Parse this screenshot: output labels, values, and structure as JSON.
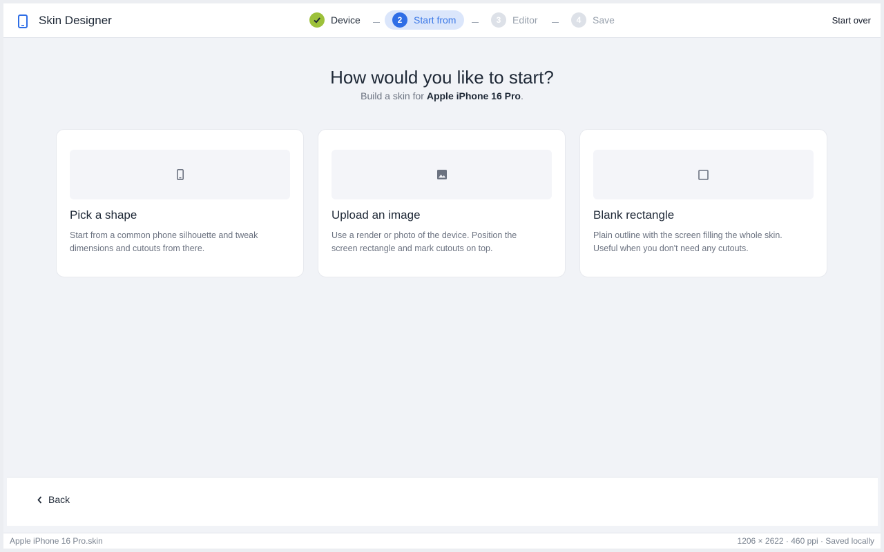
{
  "app": {
    "title": "Skin Designer",
    "logo_icon": "phone-icon"
  },
  "stepper": {
    "steps": [
      {
        "number": "1",
        "label": "Device",
        "state": "done"
      },
      {
        "number": "2",
        "label": "Start from",
        "state": "active"
      },
      {
        "number": "3",
        "label": "Editor",
        "state": "todo"
      },
      {
        "number": "4",
        "label": "Save",
        "state": "todo"
      }
    ]
  },
  "header": {
    "start_over_label": "Start over"
  },
  "hero": {
    "title": "How would you like to start?",
    "subtitle_prefix": "Build a skin for ",
    "device_name": "Apple iPhone 16 Pro",
    "subtitle_suffix": "."
  },
  "options": [
    {
      "icon": "phone-icon",
      "title": "Pick a shape",
      "description": "Start from a common phone silhouette and tweak dimensions and cutouts from there."
    },
    {
      "icon": "image-icon",
      "title": "Upload an image",
      "description": "Use a render or photo of the device. Position the screen rectangle and mark cutouts on top."
    },
    {
      "icon": "square-icon",
      "title": "Blank rectangle",
      "description": "Plain outline with the screen filling the whole skin. Useful when you don't need any cutouts."
    }
  ],
  "footer": {
    "back_label": "Back"
  },
  "status": {
    "filename": "Apple iPhone 16 Pro.skin",
    "info": "1206 × 2622 · 460 ppi · Saved locally"
  },
  "colors": {
    "accent": "#2f6ee6",
    "done": "#9dc13a",
    "background": "#f1f3f7"
  }
}
